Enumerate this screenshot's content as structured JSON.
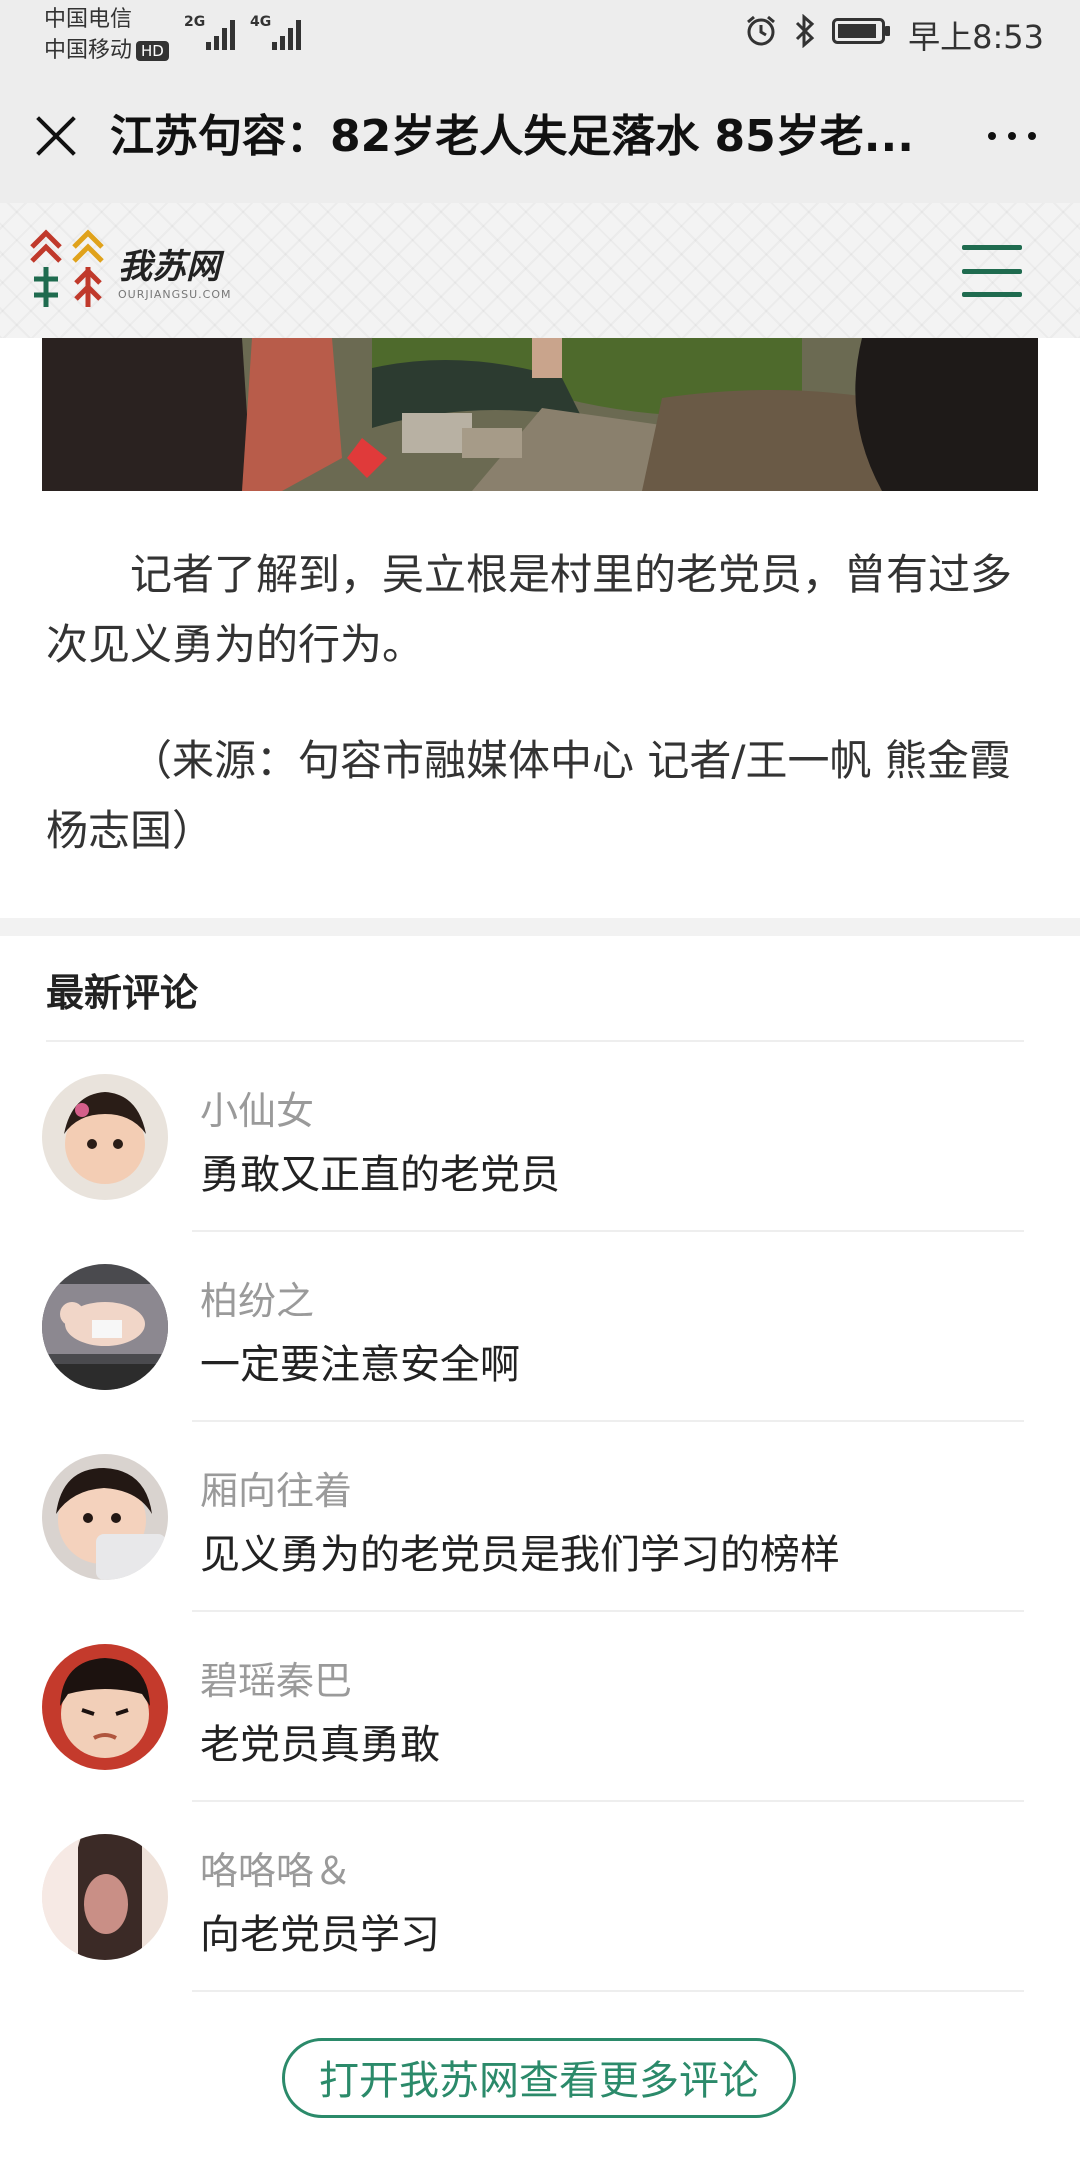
{
  "status_bar": {
    "carrier1": "中国电信",
    "carrier2": "中国移动",
    "hd": "HD",
    "net1": "2G",
    "net2": "4G",
    "time": "早上8:53",
    "icons": [
      "alarm-icon",
      "bluetooth-icon",
      "battery-icon"
    ]
  },
  "nav": {
    "title": "江苏句容：82岁老人失足落水  85岁老..."
  },
  "site": {
    "name": "我苏网",
    "domain": "OURJIANGSU.COM",
    "brand_color": "#1f6b4f"
  },
  "article": {
    "paragraph": "记者了解到，吴立根是村里的老党员，曾有过多次见义勇为的行为。",
    "source": "（来源：句容市融媒体中心   记者/王一帆 熊金霞 杨志国）"
  },
  "comments": {
    "title": "最新评论",
    "items": [
      {
        "name": "小仙女",
        "text": "勇敢又正直的老党员"
      },
      {
        "name": "柏纷之",
        "text": "一定要注意安全啊"
      },
      {
        "name": "厢向往着",
        "text": "见义勇为的老党员是我们学习的榜样"
      },
      {
        "name": "碧瑶秦巴",
        "text": "老党员真勇敢"
      },
      {
        "name": "咯咯咯＆",
        "text": "向老党员学习"
      }
    ],
    "more_button": "打开我苏网查看更多评论"
  },
  "colors": {
    "accent": "#2b8a6a",
    "nav_bg": "#ededed"
  }
}
